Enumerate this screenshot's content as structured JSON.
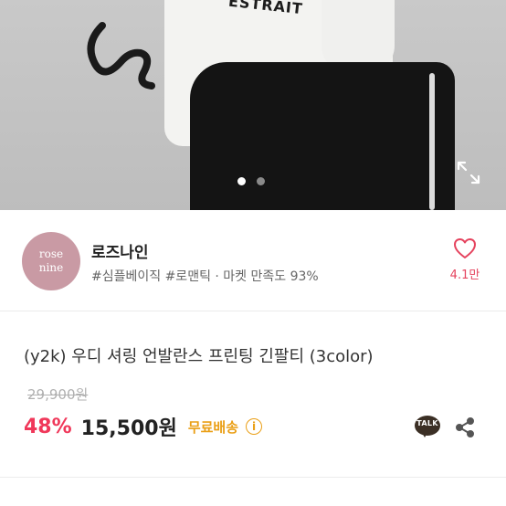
{
  "photo": {
    "print_text": "ESTRAIT",
    "carousel_dots": 2,
    "active_dot": 1,
    "expand_icon": "expand-icon"
  },
  "shop": {
    "logo_line1": "rose",
    "logo_line2": "nine",
    "name": "로즈나인",
    "tags": "#심플베이직 #로맨틱 · 마켓 만족도 93%",
    "like_count": "4.1만",
    "like_icon": "heart-outline-icon"
  },
  "product": {
    "title": "(y2k) 우디 셔링 언발란스 프린팅 긴팔티 (3color)",
    "original_price": "29,900원",
    "discount": "48%",
    "price": "15,500원",
    "shipping": "무료배송",
    "info_icon_glyph": "i",
    "talk_label": "TALK",
    "share_icon": "share-icon"
  },
  "colors": {
    "discount": "#f0385a",
    "shipping": "#ea9f16",
    "heart": "#e5435e",
    "logo_bg": "#c99aa4"
  }
}
